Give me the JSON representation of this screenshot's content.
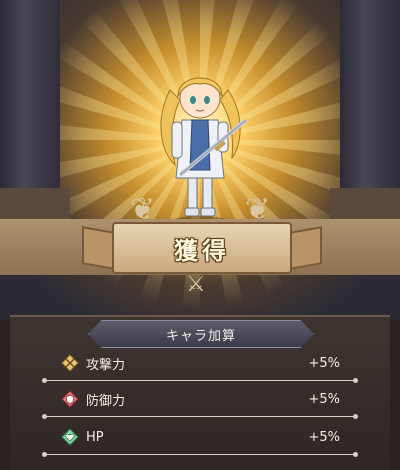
{
  "banner": {
    "title": "獲得"
  },
  "bonus_panel": {
    "header": "キャラ加算",
    "stats": [
      {
        "icon": "sword-icon",
        "label": "攻撃力",
        "value": "+5%",
        "color": "#e9c87a"
      },
      {
        "icon": "shield-icon",
        "label": "防御力",
        "value": "+5%",
        "color": "#e07a7a"
      },
      {
        "icon": "heart-icon",
        "label": "HP",
        "value": "+5%",
        "color": "#8fd3a0"
      }
    ]
  },
  "colors": {
    "glow": "#ffd36b",
    "ribbon": "#c9aa7c",
    "panel": "#2f2725"
  }
}
